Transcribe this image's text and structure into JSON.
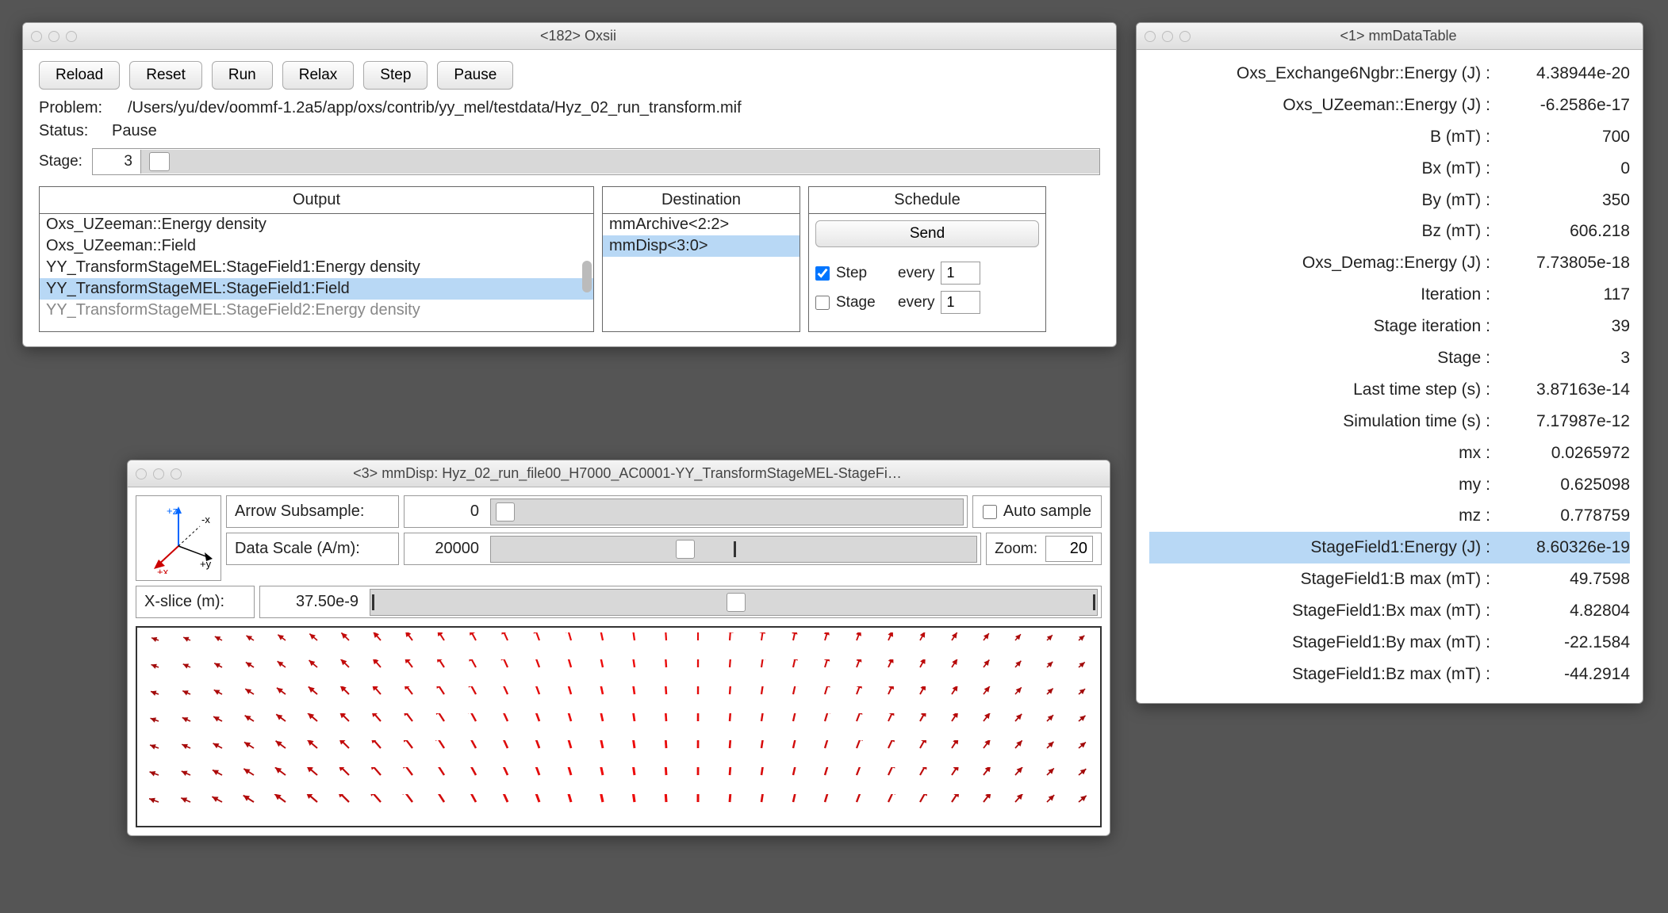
{
  "oxsii": {
    "title": "<182> Oxsii",
    "buttons": {
      "reload": "Reload",
      "reset": "Reset",
      "run": "Run",
      "relax": "Relax",
      "step": "Step",
      "pause": "Pause"
    },
    "problem_label": "Problem:",
    "problem_path": "/Users/yu/dev/oommf-1.2a5/app/oxs/contrib/yy_mel/testdata/Hyz_02_run_transform.mif",
    "status_label": "Status:",
    "status_value": "Pause",
    "stage_label": "Stage:",
    "stage_value": "3",
    "columns": {
      "output": "Output",
      "destination": "Destination",
      "schedule": "Schedule"
    },
    "output_items": [
      {
        "text": "Oxs_UZeeman::Energy density",
        "selected": false
      },
      {
        "text": "Oxs_UZeeman::Field",
        "selected": false
      },
      {
        "text": "YY_TransformStageMEL:StageField1:Energy density",
        "selected": false
      },
      {
        "text": "YY_TransformStageMEL:StageField1:Field",
        "selected": true
      },
      {
        "text": "YY_TransformStageMEL:StageField2:Energy density",
        "selected": false,
        "faded": true
      }
    ],
    "destination_items": [
      {
        "text": "mmArchive<2:2>",
        "selected": false
      },
      {
        "text": "mmDisp<3:0>",
        "selected": true
      }
    ],
    "schedule": {
      "send": "Send",
      "step_label": "Step",
      "step_checked": true,
      "stage_label": "Stage",
      "stage_checked": false,
      "every_label": "every",
      "step_every": "1",
      "stage_every": "1"
    }
  },
  "dataTable": {
    "title": "<1> mmDataTable",
    "rows": [
      {
        "label": "Oxs_Exchange6Ngbr::Energy (J)",
        "value": "4.38944e-20"
      },
      {
        "label": "Oxs_UZeeman::Energy (J)",
        "value": "-6.2586e-17"
      },
      {
        "label": "B (mT)",
        "value": "700"
      },
      {
        "label": "Bx (mT)",
        "value": "0"
      },
      {
        "label": "By (mT)",
        "value": "350"
      },
      {
        "label": "Bz (mT)",
        "value": "606.218"
      },
      {
        "label": "Oxs_Demag::Energy (J)",
        "value": "7.73805e-18"
      },
      {
        "label": "Iteration",
        "value": "117"
      },
      {
        "label": "Stage iteration",
        "value": "39"
      },
      {
        "label": "Stage",
        "value": "3"
      },
      {
        "label": "Last time step (s)",
        "value": "3.87163e-14"
      },
      {
        "label": "Simulation time (s)",
        "value": "7.17987e-12"
      },
      {
        "label": "mx",
        "value": "0.0265972"
      },
      {
        "label": "my",
        "value": "0.625098"
      },
      {
        "label": "mz",
        "value": "0.778759"
      },
      {
        "label": "StageField1:Energy (J)",
        "value": "8.60326e-19",
        "hl": true
      },
      {
        "label": "StageField1:B max (mT)",
        "value": "49.7598"
      },
      {
        "label": "StageField1:Bx max (mT)",
        "value": "4.82804"
      },
      {
        "label": "StageField1:By max (mT)",
        "value": "-22.1584"
      },
      {
        "label": "StageField1:Bz max (mT)",
        "value": "-44.2914"
      }
    ]
  },
  "disp": {
    "title": "<3> mmDisp: Hyz_02_run_file00_H7000_AC0001-YY_TransformStageMEL-StageFi…",
    "arrow_subsample_label": "Arrow Subsample:",
    "arrow_subsample_value": "0",
    "auto_sample_label": "Auto sample",
    "auto_sample_checked": false,
    "data_scale_label": "Data Scale (A/m):",
    "data_scale_value": "20000",
    "zoom_label": "Zoom:",
    "zoom_value": "20",
    "xslice_label": "X-slice (m):",
    "xslice_value": "37.50e-9",
    "axes": {
      "pz": "+z",
      "mx": "-x",
      "py": "+y",
      "px": "+x"
    },
    "vector_field": {
      "rows": 7,
      "cols": 30,
      "description": "7×30 grid of arrows varying from short dark-red (upper-left) pointing down-left, to long bright-red (center, pointing straight down), to medium red (right, pointing down-right)."
    }
  }
}
